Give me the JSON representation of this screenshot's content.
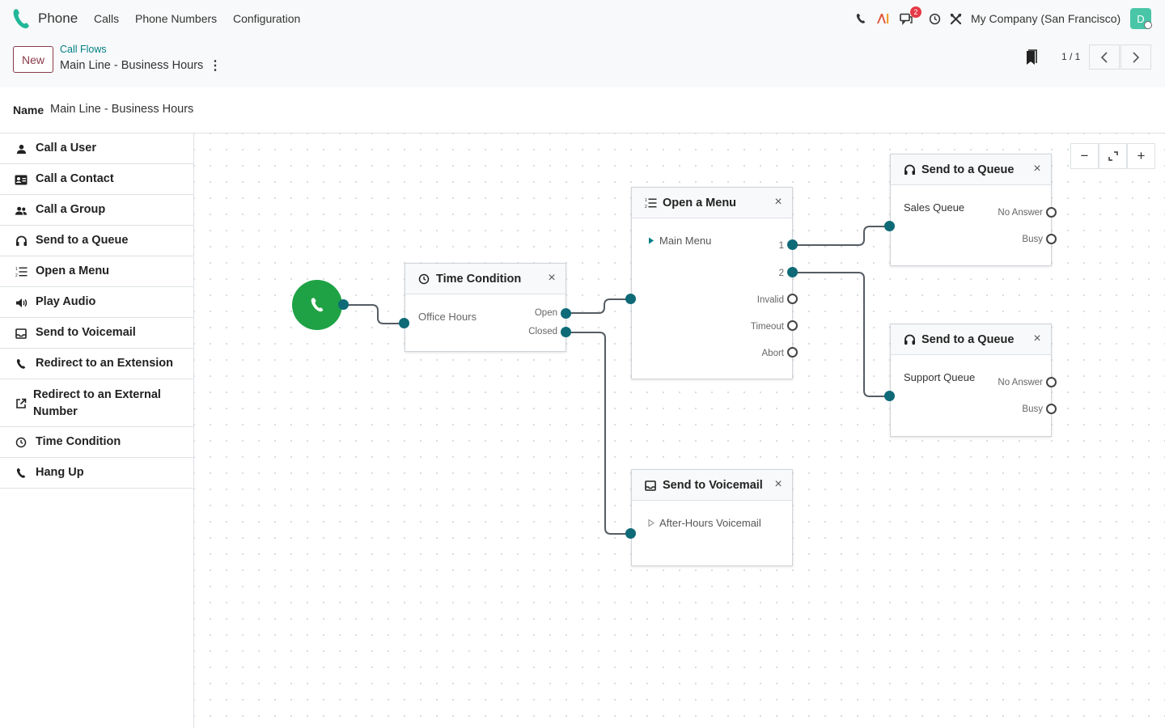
{
  "navbar": {
    "app_name": "Phone",
    "menus": [
      "Calls",
      "Phone Numbers",
      "Configuration"
    ],
    "notification_count": "2",
    "company": "My Company (San Francisco)",
    "avatar_letter": "D"
  },
  "control": {
    "new_label": "New",
    "breadcrumb_parent": "Call Flows",
    "breadcrumb_current": "Main Line - Business Hours",
    "gear_label": "⋮",
    "pager": "1 / 1"
  },
  "record": {
    "name_label": "Name",
    "name_value": "Main Line - Business Hours"
  },
  "sidebar": {
    "items": [
      {
        "label": "Call a User",
        "icon": "user-icon"
      },
      {
        "label": "Call a Contact",
        "icon": "contact-card-icon"
      },
      {
        "label": "Call a Group",
        "icon": "group-icon"
      },
      {
        "label": "Send to a Queue",
        "icon": "headset-icon"
      },
      {
        "label": "Open a Menu",
        "icon": "menu-list-icon"
      },
      {
        "label": "Play Audio",
        "icon": "speaker-icon"
      },
      {
        "label": "Send to Voicemail",
        "icon": "voicemail-inbox-icon"
      },
      {
        "label": "Redirect to an Extension",
        "icon": "phone-icon"
      },
      {
        "label": "Redirect to an External Number",
        "icon": "external-link-icon"
      },
      {
        "label": "Time Condition",
        "icon": "clock-icon"
      },
      {
        "label": "Hang Up",
        "icon": "hang-up-icon"
      }
    ]
  },
  "zoom": {
    "minus": "−",
    "plus": "+"
  },
  "nodes": {
    "time_condition": {
      "title": "Time Condition",
      "body": "Office Hours",
      "outputs": [
        "Open",
        "Closed"
      ]
    },
    "open_menu": {
      "title": "Open a Menu",
      "sub_label": "Main Menu",
      "outputs": [
        "1",
        "2",
        "Invalid",
        "Timeout",
        "Abort"
      ]
    },
    "queue_sales": {
      "title": "Send to a Queue",
      "body": "Sales Queue",
      "outputs": [
        "No Answer",
        "Busy"
      ]
    },
    "queue_support": {
      "title": "Send to a Queue",
      "body": "Support Queue",
      "outputs": [
        "No Answer",
        "Busy"
      ]
    },
    "voicemail": {
      "title": "Send to Voicemail",
      "sub_label": "After-Hours Voicemail"
    }
  },
  "colors": {
    "start_node": "#1fa245",
    "port_connected": "#0e6a77",
    "accent_link": "#017e84",
    "new_button": "#8a3a4a"
  }
}
